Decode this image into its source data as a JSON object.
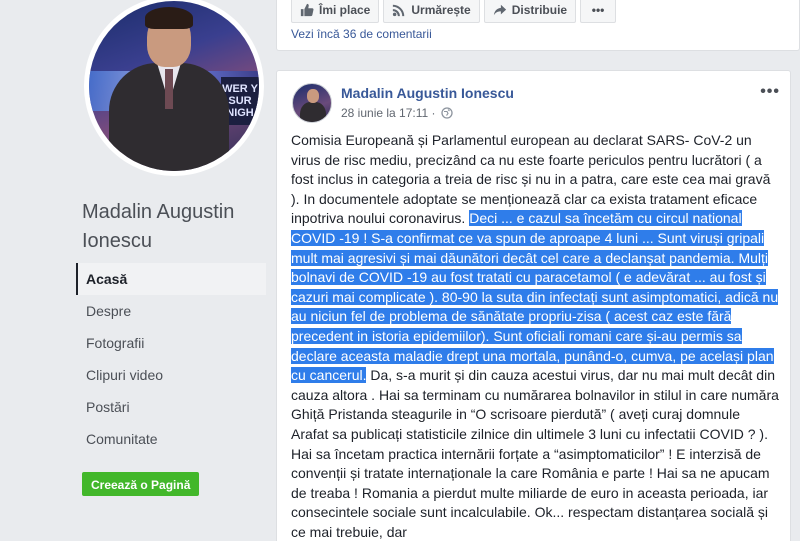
{
  "top_card": {
    "actions": [
      {
        "label": "Îmi place",
        "icon": "thumbs-up-icon"
      },
      {
        "label": "Urmărește",
        "icon": "rss-icon"
      },
      {
        "label": "Distribuie",
        "icon": "share-icon"
      }
    ],
    "more_label": "•••",
    "more_comments": "Vezi încă 36 de comentarii"
  },
  "sidebar": {
    "page_name": "Madalin Augustin Ionescu",
    "nav": [
      {
        "label": "Acasă",
        "active": true
      },
      {
        "label": "Despre"
      },
      {
        "label": "Fotografii"
      },
      {
        "label": "Clipuri video"
      },
      {
        "label": "Postări"
      },
      {
        "label": "Comunitate"
      }
    ],
    "create_page_label": "Creează o Pagină",
    "profile_sign": "WER Y SUR NIGH"
  },
  "post": {
    "author": "Madalin Augustin Ionescu",
    "date": "28 iunie la 17:11 ·",
    "menu": "•••",
    "text_before": "Comisia Europeană și Parlamentul european au declarat SARS- CoV-2 un virus de risc mediu, precizând ca nu este foarte periculos pentru lucrători ( a fost inclus in categoria a treia de risc și nu in a patra, care este cea mai gravă ). In documentele adoptate se menționează clar ca exista tratament eficace inpotriva noului coronavirus. ",
    "text_highlight": "Deci ... e cazul sa încetăm cu circul national COVID -19 ! S-a confirmat ce va spun de aproape 4 luni ... Sunt viruși gripali mult mai agresivi și mai dăunători decât cel care a declanșat pandemia. Mulți bolnavi de COVID -19 au fost tratati cu paracetamol ( e adevărat ... au fost și cazuri mai complicate ). 80-90 la suta din infectați sunt asimptomatici, adică nu au niciun fel de problema de sănătate propriu-zisa ( acest caz este fără precedent in istoria epidemiilor). Sunt oficiali romani care și-au permis sa declare aceasta maladie drept una mortala, punând-o, cumva, pe același plan cu cancerul.",
    "text_after": " Da, s-a murit și din cauza acestui virus, dar nu mai mult decât din cauza altora . Hai sa terminam cu numărarea bolnavilor in stilul in care număra Ghiță Pristanda steagurile in “O scrisoare pierdută” ( aveți curaj domnule Arafat sa publicați statisticile zilnice din ultimele 3 luni cu infectatii COVID ? ). Hai sa încetam practica internării forțate a “asimptomaticilor” ! E interzisă de convenții și tratate internaționale la care România e parte ! Hai sa ne apucam de treaba ! Romania a pierdut multe miliarde de euro in aceasta perioada, iar consecintele sociale sunt incalculabile. Ok... respectam distanțarea socială și ce mai trebuie, dar"
  }
}
